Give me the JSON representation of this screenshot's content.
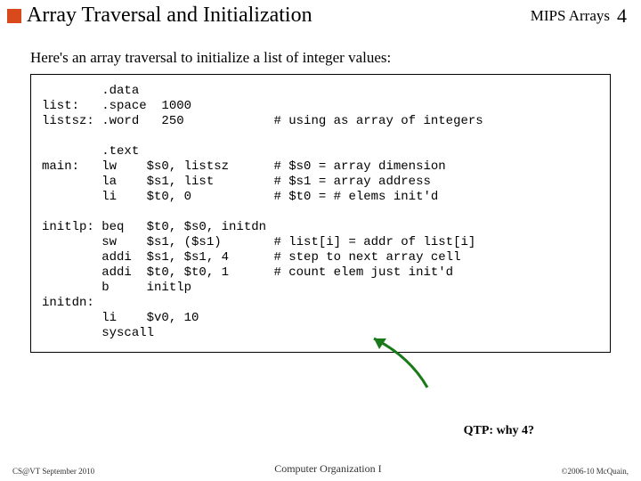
{
  "header": {
    "title": "Array Traversal and Initialization",
    "topic": "MIPS Arrays",
    "page": "4"
  },
  "intro": "Here's an array traversal to initialize a list of integer values:",
  "code": "        .data\nlist:   .space  1000\nlistsz: .word   250            # using as array of integers\n\n        .text\nmain:   lw    $s0, listsz      # $s0 = array dimension\n        la    $s1, list        # $s1 = array address\n        li    $t0, 0           # $t0 = # elems init'd\n\ninitlp: beq   $t0, $s0, initdn\n        sw    $s1, ($s1)       # list[i] = addr of list[i]\n        addi  $s1, $s1, 4      # step to next array cell\n        addi  $t0, $t0, 1      # count elem just init'd\n        b     initlp\ninitdn:\n        li    $v0, 10\n        syscall",
  "qtp": "QTP:  why 4?",
  "footer": {
    "left": "CS@VT September 2010",
    "center": "Computer Organization I",
    "right": "©2006-10  McQuain,"
  }
}
